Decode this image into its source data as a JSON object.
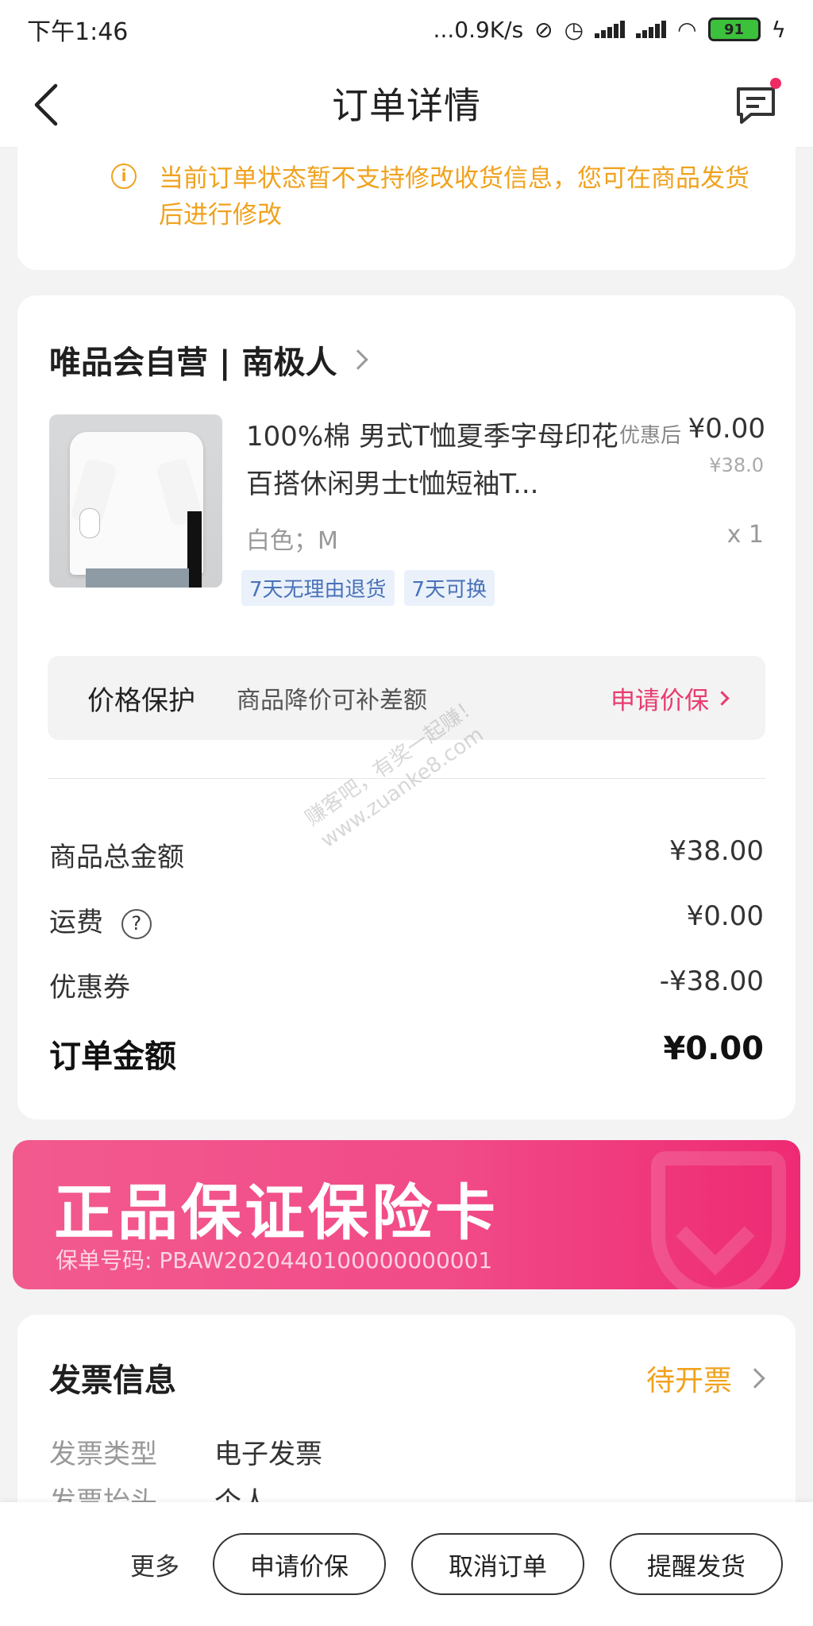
{
  "status_bar": {
    "time": "下午1:46",
    "network_speed": "...0.9K/s",
    "battery": "91"
  },
  "nav": {
    "title": "订单详情",
    "back_icon": "chevron-left-icon",
    "message_icon": "message-icon"
  },
  "notice": {
    "icon": "info-icon",
    "text": "当前订单状态暂不支持修改收货信息，您可在商品发货后进行修改"
  },
  "order": {
    "store_name": "唯品会自营 | 南极人",
    "product": {
      "title": "100%棉 男式T恤夏季字母印花百搭休闲男士t恤短袖T...",
      "price_label": "优惠后",
      "price_now": "¥0.00",
      "price_original": "¥38.0",
      "spec": "白色；M",
      "quantity": "x 1",
      "tags": [
        "7天无理由退货",
        "7天可换"
      ]
    },
    "price_protection": {
      "title": "价格保护",
      "desc": "商品降价可补差额",
      "action": "申请价保"
    },
    "summary": [
      {
        "label": "商品总金额",
        "value": "¥38.00"
      },
      {
        "label": "运费",
        "value": "¥0.00",
        "help": "?"
      },
      {
        "label": "优惠券",
        "value": "-¥38.00"
      }
    ],
    "total": {
      "label": "订单金额",
      "value": "¥0.00"
    }
  },
  "insurance": {
    "title": "正品保证保险卡",
    "policy_no": "保单号码: PBAW2020440100000000001"
  },
  "invoice": {
    "title": "发票信息",
    "status": "待开票",
    "type_label": "发票类型",
    "type_value": "电子发票",
    "header_label": "发票抬头",
    "header_value": "个人"
  },
  "bottom_bar": {
    "more": "更多",
    "buttons": [
      "申请价保",
      "取消订单",
      "提醒发货"
    ]
  },
  "watermark": {
    "line1": "赚客吧，有奖一起赚！",
    "line2": "www.zuanke8.com"
  },
  "colors": {
    "accent_pink": "#e83b6f",
    "warning_orange": "#f0a21e",
    "tag_blue": "#4a72b8"
  }
}
